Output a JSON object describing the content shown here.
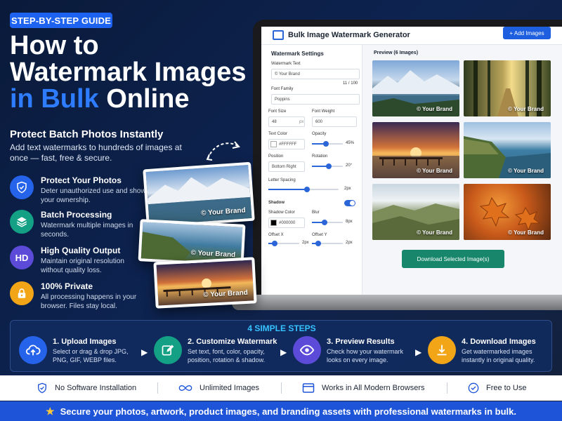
{
  "badge": "STEP-BY-STEP GUIDE",
  "headline": {
    "line1": "How to",
    "line2": "Watermark Images",
    "line3_blue": "in Bulk",
    "line3_white": " Online"
  },
  "subhead": "Protect Batch Photos Instantly",
  "intro": "Add text watermarks to hundreds of images at once — fast, free & secure.",
  "features": [
    {
      "icon": "shield-icon",
      "title": "Protect Your Photos",
      "desc": "Deter unauthorized use and show your ownership.",
      "color": "#2563eb"
    },
    {
      "icon": "layers-icon",
      "title": "Batch Processing",
      "desc": "Watermark multiple images in seconds.",
      "color": "#13a085"
    },
    {
      "icon": "hd-icon",
      "icon_text": "HD",
      "title": "High Quality Output",
      "desc": "Maintain original resolution without quality loss.",
      "color": "#5b4bd8"
    },
    {
      "icon": "lock-icon",
      "title": "100% Private",
      "desc": "All processing happens in your browser. Files stay local.",
      "color": "#f2a516"
    }
  ],
  "stack_watermark": "© Your Brand",
  "app": {
    "title": "Bulk Image Watermark Generator",
    "add_button": "+ Add Images",
    "settings_title": "Watermark Settings",
    "watermark_text_label": "Watermark Text",
    "watermark_text_value": "© Your Brand",
    "char_count": "11 / 100",
    "font_family_label": "Font Family",
    "font_family_value": "Poppins",
    "font_size_label": "Font Size",
    "font_size_value": "48",
    "font_size_unit": "px",
    "font_weight_label": "Font Weight",
    "font_weight_value": "600",
    "text_color_label": "Text Color",
    "text_color_value": "#FFFFFF",
    "opacity_label": "Opacity",
    "opacity_value": "45%",
    "opacity_level": 0.45,
    "position_label": "Position",
    "position_value": "Bottom Right",
    "rotation_label": "Rotation",
    "rotation_value": "20°",
    "rotation_level": 0.55,
    "letter_spacing_label": "Letter Spacing",
    "letter_spacing_value": "2px",
    "letter_spacing_level": 0.55,
    "shadow_label": "Shadow",
    "shadow_color_label": "Shadow Color",
    "shadow_color_value": "#000000",
    "blur_label": "Blur",
    "blur_value": "8px",
    "blur_level": 0.4,
    "offset_x_label": "Offset X",
    "offset_x_value": "2px",
    "offset_x_level": 0.2,
    "offset_y_label": "Offset Y",
    "offset_y_value": "2px",
    "offset_y_level": 0.2,
    "preview_title": "Preview (6 Images)",
    "tile_watermark": "© Your Brand",
    "download_button": "Download Selected Image(s)"
  },
  "steps_title": "4 SIMPLE STEPS",
  "steps": [
    {
      "title": "1. Upload Images",
      "desc": "Select or drag & drop JPG, PNG, GIF, WEBP files.",
      "icon": "upload-icon",
      "color": "#2563eb"
    },
    {
      "title": "2. Customize Watermark",
      "desc": "Set text, font, color, opacity, position, rotation & shadow.",
      "icon": "edit-icon",
      "color": "#13a085"
    },
    {
      "title": "3. Preview Results",
      "desc": "Check how your watermark looks on every image.",
      "icon": "eye-icon",
      "color": "#5b4bd8"
    },
    {
      "title": "4. Download Images",
      "desc": "Get watermarked images instantly in original quality.",
      "icon": "download-icon",
      "color": "#f2a516"
    }
  ],
  "benefits": [
    {
      "icon": "shield-check-icon",
      "label": "No Software Installation"
    },
    {
      "icon": "infinity-icon",
      "label": "Unlimited Images"
    },
    {
      "icon": "browser-icon",
      "label": "Works in All Modern Browsers"
    },
    {
      "icon": "check-circle-icon",
      "label": "Free to Use"
    }
  ],
  "footer": "Secure your photos, artwork, product images, and branding assets with professional watermarks in bulk."
}
